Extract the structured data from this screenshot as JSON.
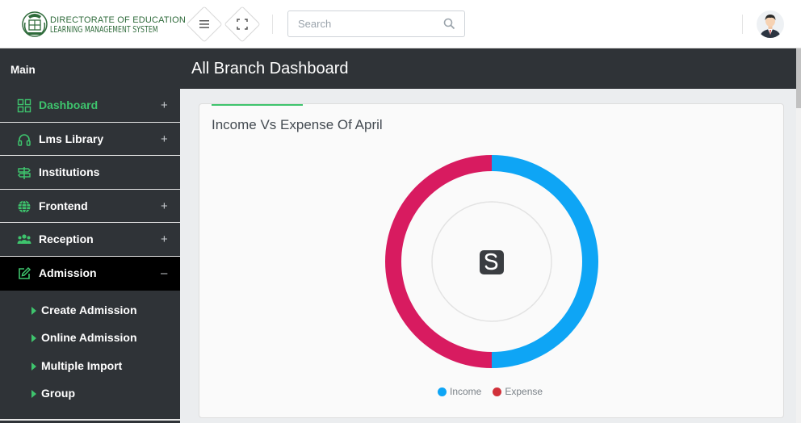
{
  "header": {
    "logo_line1": "DIRECTORATE OF EDUCATION",
    "logo_line2": "LEARNING MANAGEMENT SYSTEM",
    "search_placeholder": "Search"
  },
  "sidebar": {
    "heading": "Main",
    "items": [
      {
        "label": "Dashboard",
        "expander": "+"
      },
      {
        "label": "Lms Library",
        "expander": "+"
      },
      {
        "label": "Institutions",
        "expander": ""
      },
      {
        "label": "Frontend",
        "expander": "+"
      },
      {
        "label": "Reception",
        "expander": "+"
      },
      {
        "label": "Admission",
        "expander": "–"
      }
    ],
    "admission_sub": [
      "Create Admission",
      "Online Admission",
      "Multiple Import",
      "Group"
    ]
  },
  "page": {
    "title": "All Branch Dashboard"
  },
  "card": {
    "title": "Income Vs Expense Of April"
  },
  "chart_data": {
    "type": "pie",
    "donut": true,
    "title": "Income Vs Expense Of April",
    "series": [
      {
        "name": "Income",
        "value": 50,
        "color": "#0ea5f5"
      },
      {
        "name": "Expense",
        "value": 50,
        "color": "#d81b60"
      }
    ],
    "legend_position": "bottom",
    "legend_colors": {
      "Income": "#0ea5f5",
      "Expense": "#d1313a"
    }
  },
  "colors": {
    "sidebar_bg": "#2f3337",
    "accent_green": "#3ec46d",
    "active_bg": "#000000"
  }
}
